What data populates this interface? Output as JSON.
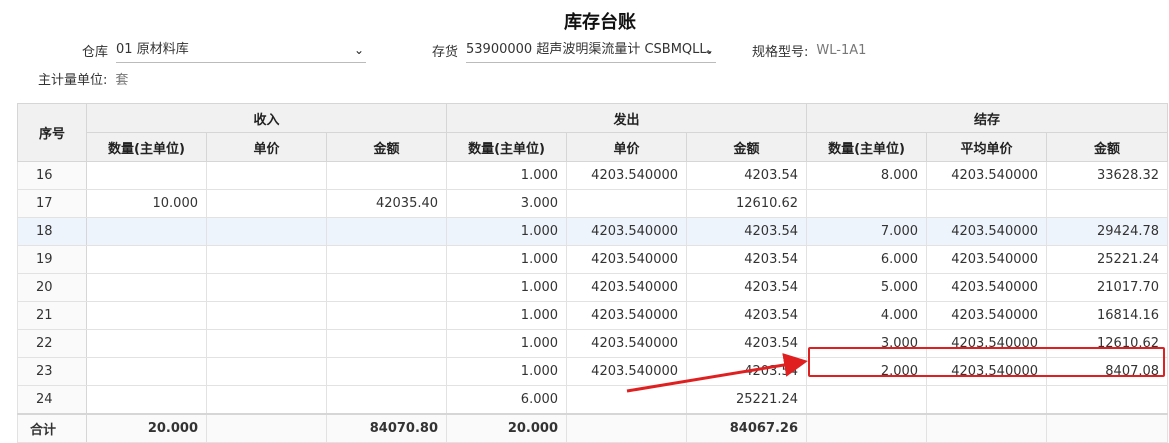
{
  "title": "库存台账",
  "filters": {
    "warehouse_label": "仓库",
    "warehouse_value": "01 原材料库",
    "stock_label": "存货",
    "stock_value": "53900000 超声波明渠流量计 CSBMQLL、",
    "model_label": "规格型号:",
    "model_value": "WL-1A1",
    "unit_label": "主计量单位:",
    "unit_value": "套"
  },
  "icons": {
    "dropdown": "chevron-down-icon",
    "annotation_arrow": "arrow-icon"
  },
  "colors": {
    "highlight": "#e02020",
    "selected_row": "#eef4fc",
    "header_bg": "#f1f1f1"
  },
  "table": {
    "index_header": "序号",
    "groups": [
      "收入",
      "发出",
      "结存"
    ],
    "subheaders": [
      "数量(主单位)",
      "单价",
      "金额",
      "数量(主单位)",
      "单价",
      "金额",
      "数量(主单位)",
      "平均单价",
      "金额"
    ],
    "rows": [
      [
        "16",
        "",
        "",
        "",
        "1.000",
        "4203.540000",
        "4203.54",
        "8.000",
        "4203.540000",
        "33628.32"
      ],
      [
        "17",
        "10.000",
        "",
        "42035.40",
        "3.000",
        "",
        "12610.62",
        "",
        "",
        ""
      ],
      [
        "18",
        "",
        "",
        "",
        "1.000",
        "4203.540000",
        "4203.54",
        "7.000",
        "4203.540000",
        "29424.78"
      ],
      [
        "19",
        "",
        "",
        "",
        "1.000",
        "4203.540000",
        "4203.54",
        "6.000",
        "4203.540000",
        "25221.24"
      ],
      [
        "20",
        "",
        "",
        "",
        "1.000",
        "4203.540000",
        "4203.54",
        "5.000",
        "4203.540000",
        "21017.70"
      ],
      [
        "21",
        "",
        "",
        "",
        "1.000",
        "4203.540000",
        "4203.54",
        "4.000",
        "4203.540000",
        "16814.16"
      ],
      [
        "22",
        "",
        "",
        "",
        "1.000",
        "4203.540000",
        "4203.54",
        "3.000",
        "4203.540000",
        "12610.62"
      ],
      [
        "23",
        "",
        "",
        "",
        "1.000",
        "4203.540000",
        "4203.54",
        "2.000",
        "4203.540000",
        "8407.08"
      ],
      [
        "24",
        "",
        "",
        "",
        "6.000",
        "",
        "25221.24",
        "",
        "",
        ""
      ]
    ],
    "total": [
      "合计",
      "20.000",
      "",
      "84070.80",
      "20.000",
      "",
      "84067.26",
      "",
      "",
      ""
    ]
  }
}
